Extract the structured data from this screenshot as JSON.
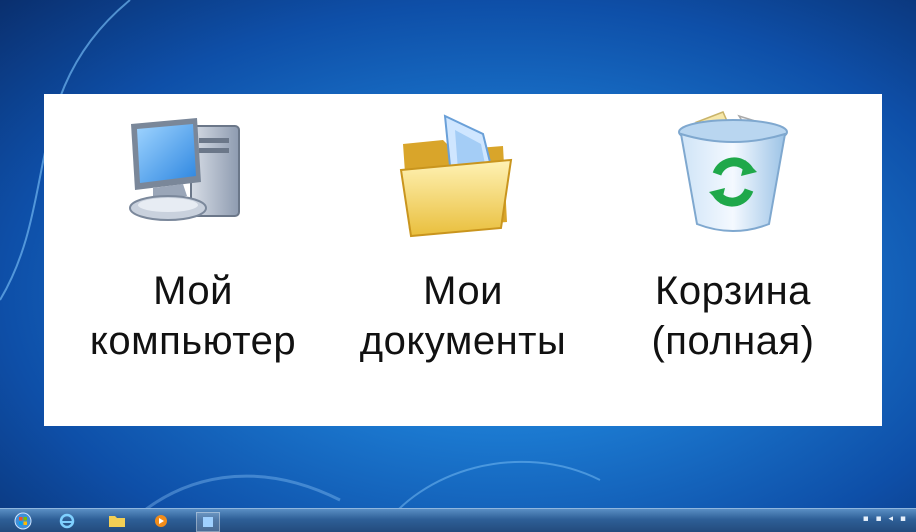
{
  "desktop": {
    "icons": [
      {
        "line1": "Мой",
        "line2": "компьютер",
        "icon": "my-computer-icon"
      },
      {
        "line1": "Мои",
        "line2": "документы",
        "icon": "my-documents-icon"
      },
      {
        "line1": "Корзина",
        "line2": "(полная)",
        "icon": "recycle-bin-full-icon"
      }
    ]
  },
  "taskbar": {
    "buttons": [
      "start-orb-icon",
      "internet-explorer-icon",
      "explorer-folder-icon",
      "media-player-icon",
      "app-icon"
    ]
  },
  "colors": {
    "desktop_blue": "#1b78cf",
    "panel_bg": "#ffffff",
    "taskbar": "#2e5f97"
  }
}
